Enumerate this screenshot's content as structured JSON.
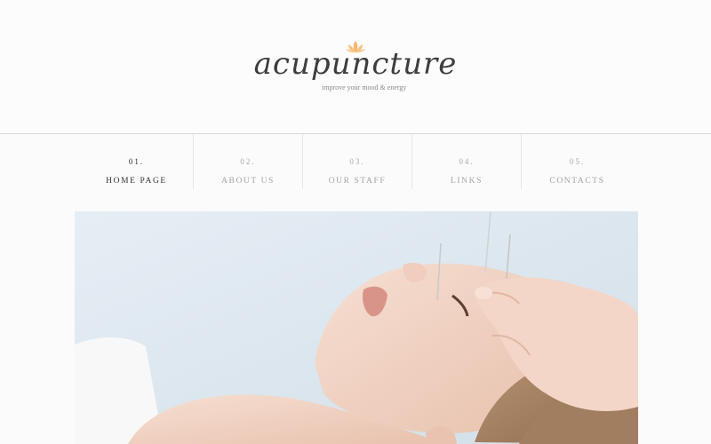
{
  "logo": {
    "name": "acupuncture",
    "tagline": "improve your mood & energy",
    "accent_color": "#f0b46a"
  },
  "nav": {
    "items": [
      {
        "num": "01.",
        "label": "HOME PAGE",
        "active": true
      },
      {
        "num": "02.",
        "label": "ABOUT US",
        "active": false
      },
      {
        "num": "03.",
        "label": "OUR STAFF",
        "active": false
      },
      {
        "num": "04.",
        "label": "LINKS",
        "active": false
      },
      {
        "num": "05.",
        "label": "CONTACTS",
        "active": false
      }
    ]
  },
  "hero": {
    "icon": "acupuncture-photo"
  }
}
